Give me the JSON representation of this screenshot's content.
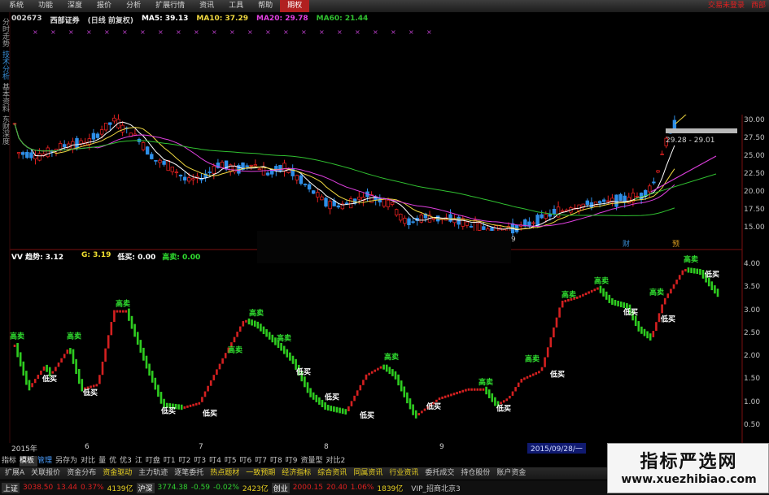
{
  "menu": {
    "items": [
      "系统",
      "功能",
      "深度",
      "报价",
      "分析",
      "扩展行情",
      "资讯",
      "工具",
      "帮助"
    ],
    "active_item": "期权",
    "right_items": [
      "交易未登录",
      "西部"
    ]
  },
  "left_tabs": [
    "分时走势",
    "技术分析",
    "基本资料",
    "东财深度"
  ],
  "stock_header": {
    "code": "002673",
    "name": "西部证券",
    "period": "(日线 前复权)",
    "ma5": "MA5: 39.13",
    "ma10": "MA10: 37.29",
    "ma20": "MA20: 29.78",
    "ma60": "MA60: 21.44"
  },
  "indicator_header": {
    "trend": "VV 趋势: 3.12",
    "g": "G: 3.19",
    "low_buy": "低买: 0.00",
    "high_sell": "高卖: 0.00"
  },
  "price_axis": [
    "30.00",
    "27.50",
    "25.00",
    "22.50",
    "20.00",
    "17.50",
    "15.00"
  ],
  "price_range_label": "29.28 - 29.01",
  "indicator_axis": [
    "4.00",
    "3.50",
    "3.00",
    "2.50",
    "2.00",
    "1.50",
    "1.00",
    "0.50"
  ],
  "date_axis": {
    "labels": [
      "2015年",
      "6",
      "7",
      "8",
      "9"
    ],
    "cursor_date": "2015/09/28/一",
    "marker": "9"
  },
  "event_markers": [
    "财",
    "预"
  ],
  "signal_labels": {
    "high": "高卖",
    "low": "低买"
  },
  "bottom_tabs_1": {
    "items": [
      "指标",
      "模板",
      "管理",
      "另存为",
      "对比",
      "量",
      "优",
      "优3",
      "江",
      "叮盘",
      "叮1",
      "叮2",
      "叮3",
      "叮4",
      "叮5",
      "叮6",
      "叮7",
      "叮8",
      "叮9",
      "资量型",
      "对比2"
    ],
    "active": "模板",
    "blue": "管理"
  },
  "bottom_tabs_2": {
    "items": [
      "扩展A",
      "关联报价",
      "资金分布",
      "资金驱动",
      "主力轨迹",
      "逐笔委托",
      "热点题材",
      "一致预期",
      "经济指标",
      "综合资讯",
      "同属资讯",
      "行业资讯",
      "委托成交",
      "持仓股份",
      "账户资金"
    ],
    "highlighted": [
      "资金驱动",
      "热点题材",
      "一致预期",
      "经济指标",
      "综合资讯",
      "同属资讯",
      "行业资讯"
    ]
  },
  "status_bar": {
    "sh_label": "上证",
    "sh_value": "3038.50",
    "sh_change": "13.44",
    "sh_pct": "0.37%",
    "sh_amount": "4139亿",
    "sz_label": "沪深",
    "sz_value": "3774.38",
    "sz_change": "-0.59",
    "sz_pct": "-0.02%",
    "sz_amount": "2423亿",
    "cy_label": "创业",
    "cy_value": "2000.15",
    "cy_change": "20.40",
    "cy_pct": "1.06%",
    "cy_amount": "1839亿",
    "vip": "VIP_招商北京3"
  },
  "watermark": {
    "title": "指标严选网",
    "url": "www.xuezhibiao.com"
  },
  "colors": {
    "up": "#e02020",
    "down": "#2e8fe8",
    "ind_up": "#d42020",
    "ind_down": "#2ecc20",
    "ma5": "#ffffff",
    "ma10": "#f0d840",
    "ma20": "#e040e0",
    "ma60": "#30c030",
    "text_yellow": "#f0e030",
    "text_green": "#30e030"
  }
}
